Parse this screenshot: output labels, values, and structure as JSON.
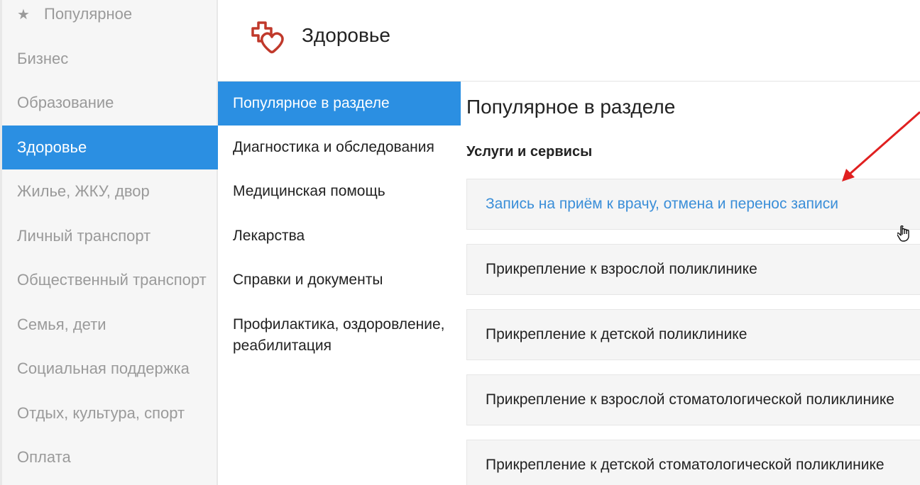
{
  "categories": [
    {
      "label": "Популярное",
      "active": false,
      "icon": "star-icon"
    },
    {
      "label": "Бизнес",
      "active": false
    },
    {
      "label": "Образование",
      "active": false
    },
    {
      "label": "Здоровье",
      "active": true
    },
    {
      "label": "Жилье, ЖКУ, двор",
      "active": false
    },
    {
      "label": "Личный транспорт",
      "active": false
    },
    {
      "label": "Общественный транспорт",
      "active": false
    },
    {
      "label": "Семья, дети",
      "active": false
    },
    {
      "label": "Социальная поддержка",
      "active": false
    },
    {
      "label": "Отдых, культура, спорт",
      "active": false
    },
    {
      "label": "Оплата",
      "active": false
    }
  ],
  "header": {
    "title": "Здоровье",
    "icon": "health-heart-cross-icon",
    "icon_color": "#c0392b"
  },
  "subsections": [
    {
      "label": "Популярное в разделе",
      "active": true
    },
    {
      "label": "Диагностика и обследования",
      "active": false
    },
    {
      "label": "Медицинская помощь",
      "active": false
    },
    {
      "label": "Лекарства",
      "active": false
    },
    {
      "label": "Справки и документы",
      "active": false
    },
    {
      "label": "Профилактика, оздоровление,",
      "label2": "реабилитация",
      "active": false
    }
  ],
  "content": {
    "title": "Популярное в разделе",
    "section_label": "Услуги и сервисы",
    "services": [
      {
        "label": "Запись на приём к врачу, отмена и перенос записи",
        "highlighted": true
      },
      {
        "label": "Прикрепление к взрослой поликлинике",
        "highlighted": false
      },
      {
        "label": "Прикрепление к детской поликлинике",
        "highlighted": false
      },
      {
        "label": "Прикрепление к взрослой стоматологической поликлинике",
        "highlighted": false
      },
      {
        "label": "Прикрепление к детской стоматологической поликлинике",
        "highlighted": false
      }
    ]
  },
  "colors": {
    "accent": "#2b8fe2",
    "link": "#3a8ed8",
    "annotation_arrow": "#e02020"
  }
}
